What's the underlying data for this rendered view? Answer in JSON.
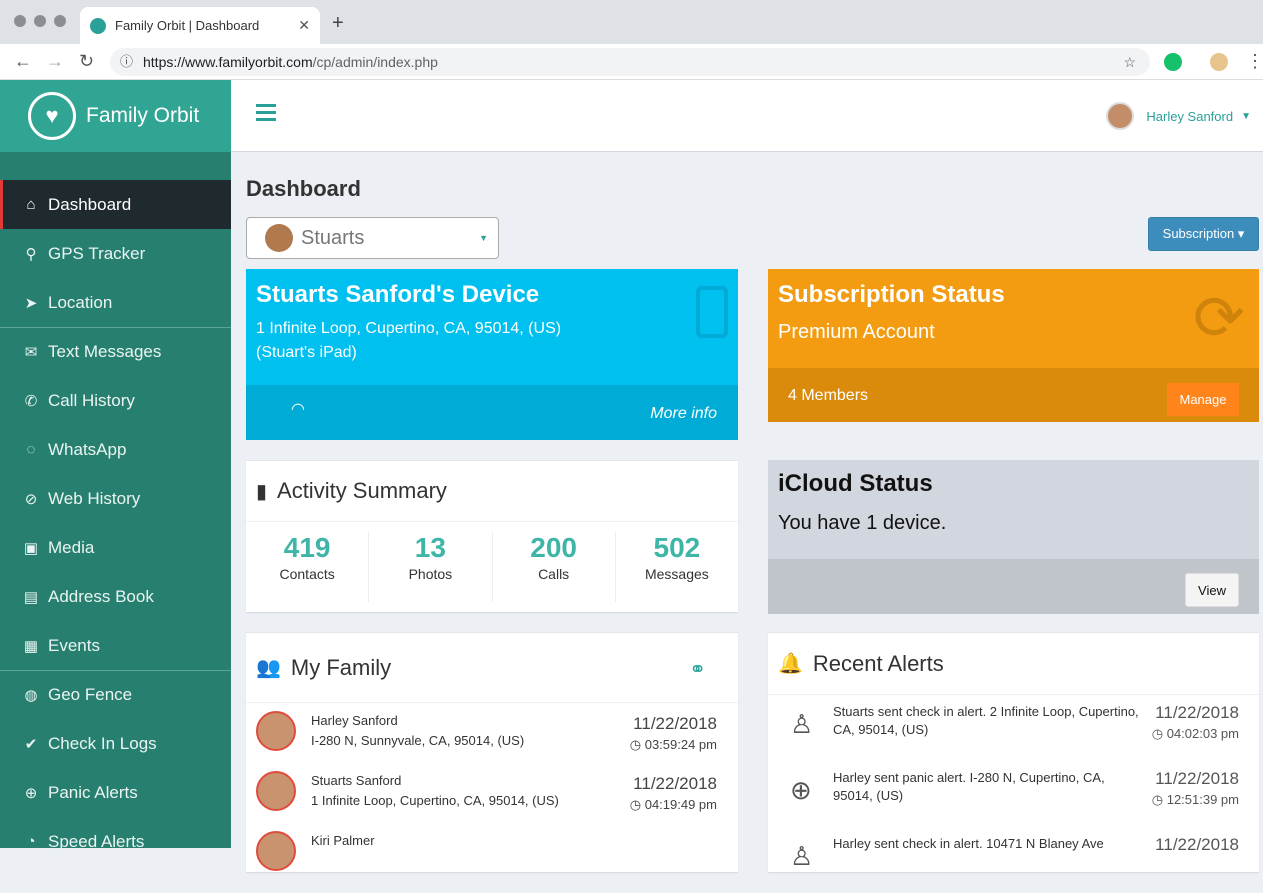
{
  "browser": {
    "tab_title": "Family Orbit | Dashboard",
    "url_host": "https://www.familyorbit.com",
    "url_path": "/cp/admin/index.php"
  },
  "brand": {
    "name": "Family Orbit"
  },
  "sidebar": {
    "items": [
      {
        "label": "Dashboard",
        "icon": "home-icon",
        "glyph": "⌂"
      },
      {
        "label": "GPS Tracker",
        "icon": "map-marker-icon",
        "glyph": "⚲"
      },
      {
        "label": "Location",
        "icon": "paper-plane-icon",
        "glyph": "➤"
      },
      {
        "label": "Text Messages",
        "icon": "chat-icon",
        "glyph": "✉"
      },
      {
        "label": "Call History",
        "icon": "phone-icon",
        "glyph": "✆"
      },
      {
        "label": "WhatsApp",
        "icon": "whatsapp-icon",
        "glyph": "◌"
      },
      {
        "label": "Web History",
        "icon": "compass-icon",
        "glyph": "⊘"
      },
      {
        "label": "Media",
        "icon": "image-icon",
        "glyph": "▣"
      },
      {
        "label": "Address Book",
        "icon": "book-icon",
        "glyph": "▤"
      },
      {
        "label": "Events",
        "icon": "calendar-icon",
        "glyph": "▦"
      },
      {
        "label": "Geo Fence",
        "icon": "globe-icon",
        "glyph": "◍"
      },
      {
        "label": "Check In Logs",
        "icon": "check-circle-icon",
        "glyph": "✔"
      },
      {
        "label": "Panic Alerts",
        "icon": "life-ring-icon",
        "glyph": "⊕"
      },
      {
        "label": "Speed Alerts",
        "icon": "speedometer-icon",
        "glyph": "◔"
      }
    ]
  },
  "header": {
    "user_name": "Harley Sanford"
  },
  "page": {
    "title": "Dashboard",
    "selected_member": "Stuarts",
    "subscription_btn": "Subscription ▾"
  },
  "device": {
    "title": "Stuarts Sanford's Device",
    "address": "1 Infinite Loop, Cupertino, CA, 95014, (US)",
    "model": "(Stuart's iPad)",
    "more": "More info"
  },
  "subscription": {
    "title": "Subscription Status",
    "plan": "Premium Account",
    "members": "4 Members",
    "manage": "Manage"
  },
  "activity": {
    "title": "Activity Summary",
    "stats": [
      {
        "value": "419",
        "label": "Contacts"
      },
      {
        "value": "13",
        "label": "Photos"
      },
      {
        "value": "200",
        "label": "Calls"
      },
      {
        "value": "502",
        "label": "Messages"
      }
    ]
  },
  "icloud": {
    "title": "iCloud Status",
    "message": "You have 1 device.",
    "view": "View"
  },
  "family": {
    "title": "My Family",
    "members": [
      {
        "name": "Harley Sanford",
        "address": "I-280 N, Sunnyvale, CA, 95014, (US)",
        "date": "11/22/2018",
        "time": "03:59:24 pm"
      },
      {
        "name": "Stuarts Sanford",
        "address": "1 Infinite Loop, Cupertino, CA, 95014, (US)",
        "date": "11/22/2018",
        "time": "04:19:49 pm"
      },
      {
        "name": "Kiri Palmer",
        "address": "",
        "date": "",
        "time": ""
      }
    ]
  },
  "alerts": {
    "title": "Recent Alerts",
    "items": [
      {
        "text": "Stuarts sent check in alert. 2 Infinite Loop, Cupertino, CA, 95014, (US)",
        "date": "11/22/2018",
        "time": "04:02:03 pm"
      },
      {
        "text": "Harley sent panic alert. I-280 N, Cupertino, CA, 95014, (US)",
        "date": "11/22/2018",
        "time": "12:51:39 pm"
      },
      {
        "text": "Harley sent check in alert. 10471 N Blaney Ave",
        "date": "11/22/2018",
        "time": ""
      }
    ]
  }
}
